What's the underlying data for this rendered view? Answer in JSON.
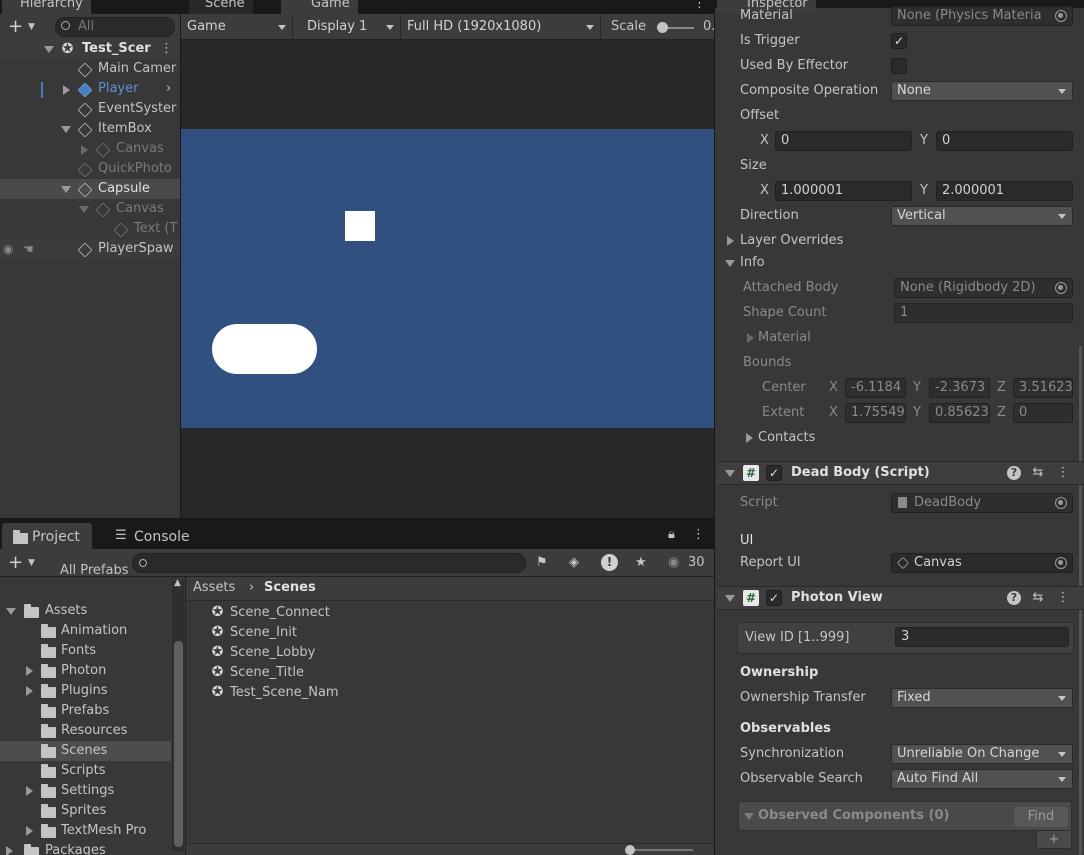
{
  "hierarchy": {
    "tab": "Hierarchy",
    "search_placeholder": "All",
    "items": [
      {
        "label": "Test_Scer"
      },
      {
        "label": "Main Camer"
      },
      {
        "label": "Player"
      },
      {
        "label": "EventSyster"
      },
      {
        "label": "ItemBox"
      },
      {
        "label": "Canvas"
      },
      {
        "label": "QuickPhoto"
      },
      {
        "label": "Capsule"
      },
      {
        "label": "Canvas"
      },
      {
        "label": "Text (T"
      },
      {
        "label": "PlayerSpaw"
      }
    ]
  },
  "scene_tab": "Scene",
  "game": {
    "tab": "Game",
    "mode": "Game",
    "display": "Display 1",
    "resolution": "Full HD (1920x1080)",
    "scale_label": "Scale",
    "scale_value": "0.",
    "bg_color": "#30507f"
  },
  "project": {
    "tab": "Project",
    "console_tab": "Console",
    "count": "30",
    "tree_partial": "All Prefabs",
    "tree": [
      "Assets",
      "Animation",
      "Fonts",
      "Photon",
      "Plugins",
      "Prefabs",
      "Resources",
      "Scenes",
      "Scripts",
      "Settings",
      "Sprites",
      "TextMesh Pro",
      "Packages"
    ],
    "breadcrumb": [
      "Assets",
      "Scenes"
    ],
    "files": [
      "Scene_Connect",
      "Scene_Init",
      "Scene_Lobby",
      "Scene_Title",
      "Test_Scene_Nam"
    ]
  },
  "inspector": {
    "tab": "Inspector",
    "material_label": "Material",
    "material_value": "None (Physics Materia",
    "is_trigger_label": "Is Trigger",
    "is_trigger_mark": "✓",
    "used_by_effector_label": "Used By Effector",
    "composite_label": "Composite Operation",
    "composite_value": "None",
    "offset_label": "Offset",
    "x": "X",
    "y": "Y",
    "z": "Z",
    "offset_x": "0",
    "offset_y": "0",
    "size_label": "Size",
    "size_x": "1.000001",
    "size_y": "2.000001",
    "direction_label": "Direction",
    "direction_value": "Vertical",
    "layer_overrides": "Layer Overrides",
    "info": "Info",
    "attached_body_label": "Attached Body",
    "attached_body_value": "None (Rigidbody 2D)",
    "shape_count_label": "Shape Count",
    "shape_count_value": "1",
    "info_material": "Material",
    "bounds_label": "Bounds",
    "center_label": "Center",
    "center_x": "-6.1184",
    "center_y": "-2.3673",
    "center_z": "3.51623",
    "extent_label": "Extent",
    "extent_x": "1.75549",
    "extent_y": "0.85623",
    "extent_z": "0",
    "contacts": "Contacts",
    "dead_body_title": "Dead Body (Script)",
    "script_label": "Script",
    "script_value": "DeadBody",
    "ui_header": "UI",
    "report_ui_label": "Report UI",
    "report_ui_value": "Canvas",
    "photon_title": "Photon View",
    "view_id_label": "View ID [1..999]",
    "view_id_value": "3",
    "ownership_header": "Ownership",
    "ownership_transfer_label": "Ownership Transfer",
    "ownership_transfer_value": "Fixed",
    "observables_header": "Observables",
    "sync_label": "Synchronization",
    "sync_value": "Unreliable On Change",
    "obs_search_label": "Observable Search",
    "obs_search_value": "Auto Find All",
    "observed_components": "Observed Components (0)",
    "find_label": "Find",
    "plus": "+",
    "hash": "#",
    "help": "?",
    "more": "⋮"
  }
}
